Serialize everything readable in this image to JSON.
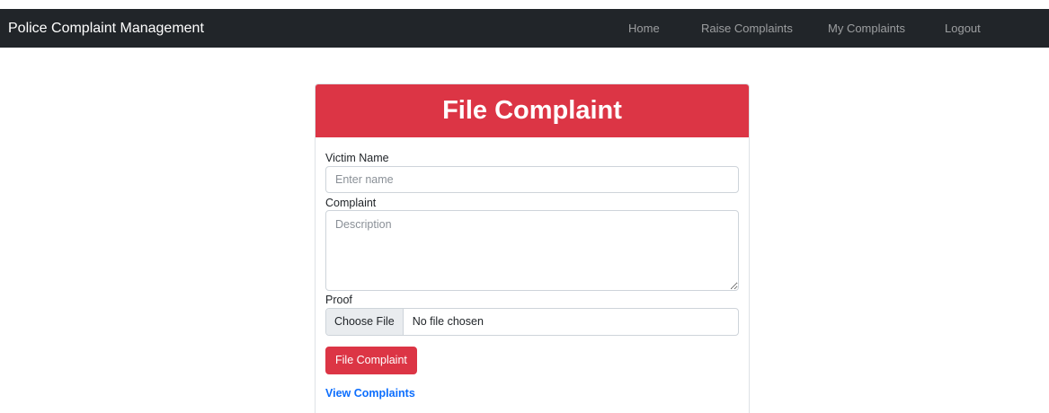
{
  "navbar": {
    "brand": "Police Complaint Management",
    "links": [
      "Home",
      "Raise Complaints",
      "My Complaints",
      "Logout"
    ]
  },
  "form": {
    "title": "File Complaint",
    "victim_label": "Victim Name",
    "victim_placeholder": "Enter name",
    "complaint_label": "Complaint",
    "complaint_placeholder": "Description",
    "proof_label": "Proof",
    "file_button": "Choose File",
    "file_status": "No file chosen",
    "submit_label": "File Complaint",
    "view_link": "View Complaints"
  },
  "colors": {
    "navbar_bg": "#212529",
    "accent": "#dc3545",
    "link": "#0d6efd"
  }
}
